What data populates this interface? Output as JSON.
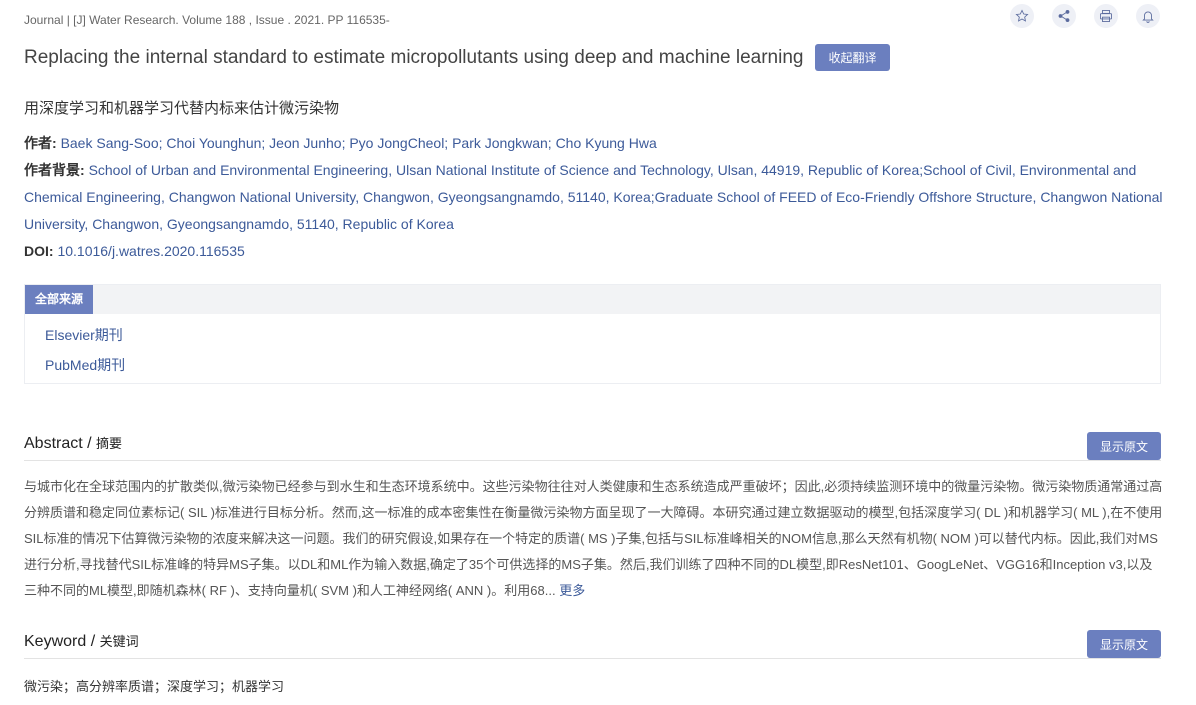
{
  "header": {
    "journal_line": "Journal | [J] Water Research. Volume 188 , Issue . 2021. PP 116535-",
    "icons": [
      "star-icon",
      "share-icon",
      "print-icon",
      "bell-icon"
    ]
  },
  "article": {
    "title": "Replacing the internal standard to estimate micropollutants using deep and machine learning",
    "translate_label": "收起翻译",
    "title_cn": "用深度学习和机器学习代替内标来估计微污染物",
    "authors_label": "作者:",
    "authors": "Baek Sang-Soo; Choi Younghun; Jeon Junho; Pyo JongCheol; Park Jongkwan; Cho Kyung Hwa",
    "affiliation_label": "作者背景:",
    "affiliation": "School of Urban and Environmental Engineering, Ulsan National Institute of Science and Technology, Ulsan, 44919, Republic of Korea;School of Civil, Environmental and Chemical Engineering, Changwon National University, Changwon, Gyeongsangnamdo, 51140, Korea;Graduate School of FEED of Eco-Friendly Offshore Structure, Changwon National University, Changwon, Gyeongsangnamdo, 51140, Republic of Korea",
    "doi_label": "DOI:",
    "doi": "10.1016/j.watres.2020.116535"
  },
  "sources": {
    "tab_label": "全部来源",
    "items": [
      "Elsevier期刊",
      "PubMed期刊"
    ]
  },
  "abstract": {
    "title_en": "Abstract",
    "separator": " / ",
    "title_cn": "摘要",
    "button_label": "显示原文",
    "text": "与城市化在全球范围内的扩散类似,微污染物已经参与到水生和生态环境系统中。这些污染物往往对人类健康和生态系统造成严重破坏；因此,必须持续监测环境中的微量污染物。微污染物质通常通过高分辨质谱和稳定同位素标记( SIL )标准进行目标分析。然而,这一标准的成本密集性在衡量微污染物方面呈现了一大障碍。本研究通过建立数据驱动的模型,包括深度学习( DL )和机器学习( ML ),在不使用SIL标准的情况下估算微污染物的浓度来解决这一问题。我们的研究假设,如果存在一个特定的质谱( MS )子集,包括与SIL标准峰相关的NOM信息,那么天然有机物( NOM )可以替代内标。因此,我们对MS进行分析,寻找替代SIL标准峰的特异MS子集。以DL和ML作为输入数据,确定了35个可供选择的MS子集。然后,我们训练了四种不同的DL模型,即ResNet101、GoogLeNet、VGG16和Inception v3,以及三种不同的ML模型,即随机森林( RF )、支持向量机( SVM )和人工神经网络( ANN )。利用68...",
    "more_label": "更多"
  },
  "keyword": {
    "title_en": "Keyword",
    "separator": " / ",
    "title_cn": "关键词",
    "button_label": "显示原文",
    "text": "微污染；高分辨率质谱；深度学习；机器学习"
  }
}
